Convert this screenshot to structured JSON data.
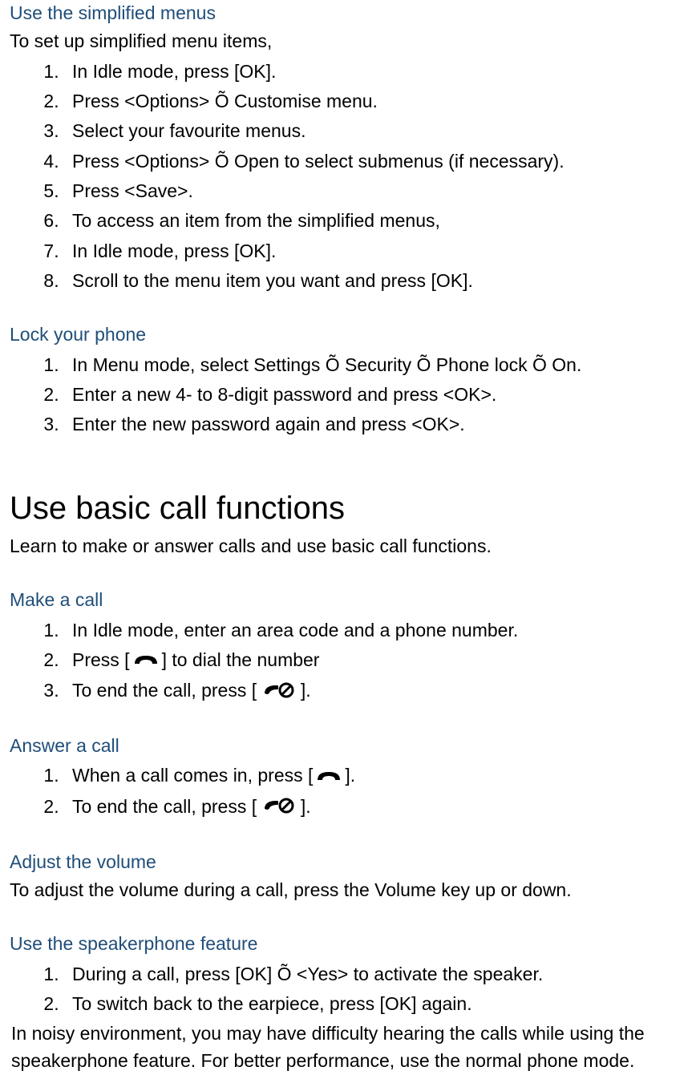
{
  "sec1": {
    "title": "Use the simplified menus",
    "intro": "To set up simplified menu items,",
    "items": [
      "In Idle mode, press [OK].",
      "Press <Options> Õ Customise menu.",
      "Select your favourite menus.",
      "Press <Options> Õ Open to select submenus (if necessary).",
      "Press <Save>.",
      "To access an item from the simplified menus,",
      "In Idle mode, press [OK].",
      "Scroll to the menu item you want and press [OK]."
    ]
  },
  "sec2": {
    "title": "Lock your phone",
    "items": [
      "In Menu mode, select Settings Õ Security Õ Phone lock Õ On.",
      "Enter a new 4- to 8-digit password and press <OK>.",
      "Enter the new password again and press <OK>."
    ]
  },
  "sec3": {
    "title": "Use basic call functions",
    "intro": "Learn to make or answer calls and use basic call functions."
  },
  "sec4": {
    "title": "Make a call",
    "item1": "In Idle mode, enter an area code and a phone number.",
    "item2_pre": "Press [",
    "item2_post": "] to dial the number",
    "item3_pre": "To end the call, press [ ",
    "item3_post": " ]."
  },
  "sec5": {
    "title": "Answer a call",
    "item1_pre": "When a call comes in, press [",
    "item1_post": "].",
    "item2_pre": "To end the call, press [ ",
    "item2_post": " ]."
  },
  "sec6": {
    "title": "Adjust the volume",
    "para": "To adjust the volume during a call, press the Volume key up or down."
  },
  "sec7": {
    "title": "Use the speakerphone feature",
    "items": [
      "During a call, press [OK] Õ <Yes> to activate the speaker.",
      "To switch back to the earpiece, press [OK] again."
    ],
    "note": "In noisy environment, you may have difficulty hearing the calls while using the speakerphone feature. For better performance, use the normal phone mode."
  }
}
